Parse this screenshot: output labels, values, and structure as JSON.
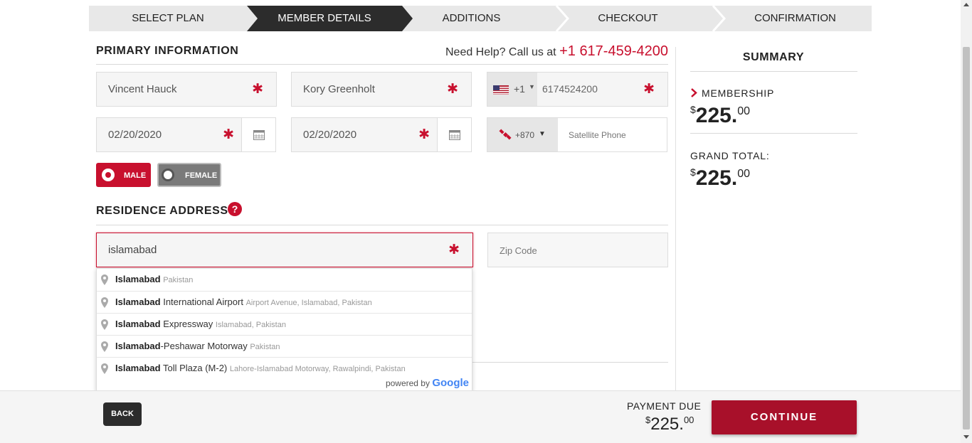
{
  "steps": [
    {
      "label": "SELECT PLAN",
      "active": false
    },
    {
      "label": "MEMBER DETAILS",
      "active": true
    },
    {
      "label": "ADDITIONS",
      "active": false
    },
    {
      "label": "CHECKOUT",
      "active": false
    },
    {
      "label": "CONFIRMATION",
      "active": false
    }
  ],
  "primary": {
    "heading": "PRIMARY INFORMATION",
    "help_prefix": "Need Help? Call us at ",
    "help_phone": "+1 617-459-4200",
    "first_name": "Vincent Hauck",
    "last_name": "Kory Greenholt",
    "phone_country_code": "+1",
    "phone_number": "6174524200",
    "date1": "02/20/2020",
    "date2": "02/20/2020",
    "sat_code": "+870",
    "sat_placeholder": "Satellite Phone",
    "required_mark": "✱",
    "gender_male": "MALE",
    "gender_female": "FEMALE"
  },
  "residence": {
    "heading": "RESIDENCE ADDRESS",
    "address_value": "islamabad",
    "zip_placeholder": "Zip Code",
    "suggestions": [
      {
        "main": "Islamabad",
        "rest": "",
        "secondary": "Pakistan"
      },
      {
        "main": "Islamabad",
        "rest": " International Airport",
        "secondary": "Airport Avenue, Islamabad, Pakistan"
      },
      {
        "main": "Islamabad",
        "rest": " Expressway",
        "secondary": "Islamabad, Pakistan"
      },
      {
        "main": "Islamabad",
        "rest": "-Peshawar Motorway",
        "secondary": "Pakistan"
      },
      {
        "main": "Islamabad",
        "rest": " Toll Plaza (M-2)",
        "secondary": "Lahore-Islamabad Motorway, Rawalpindi, Pakistan"
      }
    ],
    "powered_by": "powered by",
    "google": "Google"
  },
  "summary": {
    "title": "SUMMARY",
    "membership_label": "MEMBERSHIP",
    "membership_currency": "$",
    "membership_amount": "225.",
    "membership_cents": "00",
    "grand_total_label": "GRAND TOTAL:",
    "grand_currency": "$",
    "grand_amount": "225.",
    "grand_cents": "00"
  },
  "footer": {
    "back_label": "BACK",
    "payment_due_label": "PAYMENT DUE",
    "due_currency": "$",
    "due_amount": "225.",
    "due_cents": "00",
    "continue_label": "CONTINUE"
  },
  "colors": {
    "accent": "#c8102e",
    "dark": "#2c2c2c",
    "continue": "#a8102a"
  }
}
